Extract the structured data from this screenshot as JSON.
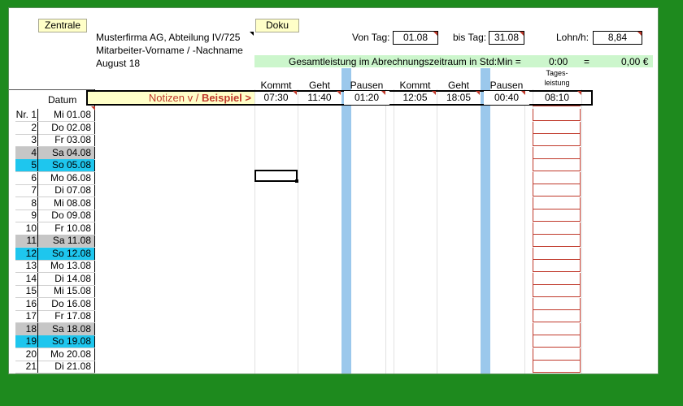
{
  "buttons": {
    "zentrale": "Zentrale",
    "doku": "Doku"
  },
  "company": {
    "line1": "Musterfirma AG, Abteilung IV/725",
    "line2": "Mitarbeiter-Vorname / -Nachname",
    "line3": "August 18"
  },
  "fields": {
    "von_tag_label": "Von Tag:",
    "von_tag_value": "01.08",
    "bis_tag_label": "bis Tag:",
    "bis_tag_value": "31.08",
    "lohn_label": "Lohn/h:",
    "lohn_value": "8,84"
  },
  "summary": {
    "label": "Gesamtleistung im Abrechnungszeitraum in Std:Min =",
    "time": "0:00",
    "eq": "=",
    "amount": "0,00 €"
  },
  "headers": {
    "kommt1": "Kommt",
    "geht1": "Geht",
    "pausen1": "Pausen",
    "kommt2": "Kommt",
    "geht2": "Geht",
    "pausen2": "Pausen",
    "tages_line1": "Tages-",
    "tages_line2": "leistung",
    "datum": "Datum"
  },
  "example": {
    "notizen_prefix": "Notizen v / ",
    "notizen_bold": "Beispiel >",
    "kommt1": "07:30",
    "geht1": "11:40",
    "pausen1": "01:20",
    "kommt2": "12:05",
    "geht2": "18:05",
    "pausen2": "00:40",
    "tages": "08:10"
  },
  "colors": {
    "weekend_sat": "#c6c6c6",
    "weekend_sun": "#1ec6ee",
    "pause_col": "#9bc8ec",
    "summary_bg": "#ccf6cc"
  },
  "rows": [
    {
      "nr": "Nr. 1",
      "date": "Mi 01.08",
      "kind": ""
    },
    {
      "nr": "2",
      "date": "Do 02.08",
      "kind": ""
    },
    {
      "nr": "3",
      "date": "Fr 03.08",
      "kind": ""
    },
    {
      "nr": "4",
      "date": "Sa 04.08",
      "kind": "sat"
    },
    {
      "nr": "5",
      "date": "So 05.08",
      "kind": "sun"
    },
    {
      "nr": "6",
      "date": "Mo 06.08",
      "kind": ""
    },
    {
      "nr": "7",
      "date": "Di 07.08",
      "kind": ""
    },
    {
      "nr": "8",
      "date": "Mi 08.08",
      "kind": ""
    },
    {
      "nr": "9",
      "date": "Do 09.08",
      "kind": ""
    },
    {
      "nr": "10",
      "date": "Fr 10.08",
      "kind": ""
    },
    {
      "nr": "11",
      "date": "Sa 11.08",
      "kind": "sat"
    },
    {
      "nr": "12",
      "date": "So 12.08",
      "kind": "sun"
    },
    {
      "nr": "13",
      "date": "Mo 13.08",
      "kind": ""
    },
    {
      "nr": "14",
      "date": "Di 14.08",
      "kind": ""
    },
    {
      "nr": "15",
      "date": "Mi 15.08",
      "kind": ""
    },
    {
      "nr": "16",
      "date": "Do 16.08",
      "kind": ""
    },
    {
      "nr": "17",
      "date": "Fr 17.08",
      "kind": ""
    },
    {
      "nr": "18",
      "date": "Sa 18.08",
      "kind": "sat"
    },
    {
      "nr": "19",
      "date": "So 19.08",
      "kind": "sun"
    },
    {
      "nr": "20",
      "date": "Mo 20.08",
      "kind": ""
    },
    {
      "nr": "21",
      "date": "Di 21.08",
      "kind": ""
    }
  ]
}
